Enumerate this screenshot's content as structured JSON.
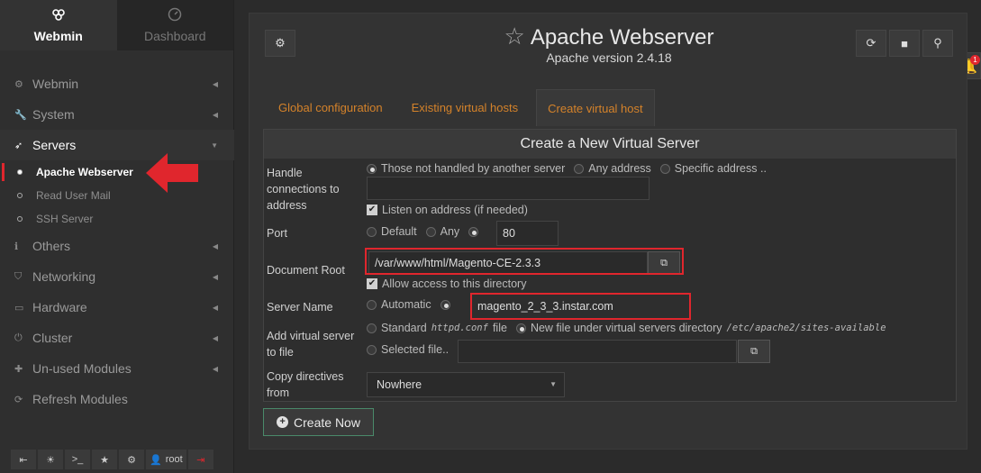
{
  "top_tabs": [
    {
      "icon": "webmin-logo-icon",
      "label": "Webmin"
    },
    {
      "icon": "dashboard-icon",
      "label": "Dashboard"
    }
  ],
  "nav": {
    "webmin": "Webmin",
    "system": "System",
    "servers": "Servers",
    "servers_sub": [
      "Apache Webserver",
      "Read User Mail",
      "SSH Server"
    ],
    "others": "Others",
    "networking": "Networking",
    "hardware": "Hardware",
    "cluster": "Cluster",
    "unused": "Un-used Modules",
    "refresh": "Refresh Modules"
  },
  "bottom_bar": {
    "user": "root"
  },
  "header": {
    "title": "Apache Webserver",
    "subtitle": "Apache version 2.4.18"
  },
  "tabs": [
    "Global configuration",
    "Existing virtual hosts",
    "Create virtual host"
  ],
  "form": {
    "heading": "Create a New Virtual Server",
    "handle_label": "Handle connections to address",
    "handle_options": [
      "Those not handled by another server",
      "Any address",
      "Specific address .."
    ],
    "listen_label": "Listen on address (if needed)",
    "port_label": "Port",
    "port_options": [
      "Default",
      "Any"
    ],
    "port_value": "80",
    "docroot_label": "Document Root",
    "docroot_value": "/var/www/html/Magento-CE-2.3.3",
    "allow_label": "Allow access to this directory",
    "servername_label": "Server Name",
    "servername_auto": "Automatic",
    "servername_value": "magento_2_3_3.instar.com",
    "addfile_label": "Add virtual server to file",
    "addfile_standard": "Standard",
    "addfile_standard_code": "httpd.conf",
    "addfile_standard_suffix": "file",
    "addfile_new": "New file under virtual servers directory",
    "addfile_new_code": "/etc/apache2/sites-available",
    "addfile_selected": "Selected file..",
    "copy_label": "Copy directives from",
    "copy_value": "Nowhere"
  },
  "create_button": "Create Now",
  "notifications_count": "1",
  "colors": {
    "accent_tab": "#d4822a",
    "highlight_red": "#e0262d",
    "button_border": "#4a8a6a"
  }
}
